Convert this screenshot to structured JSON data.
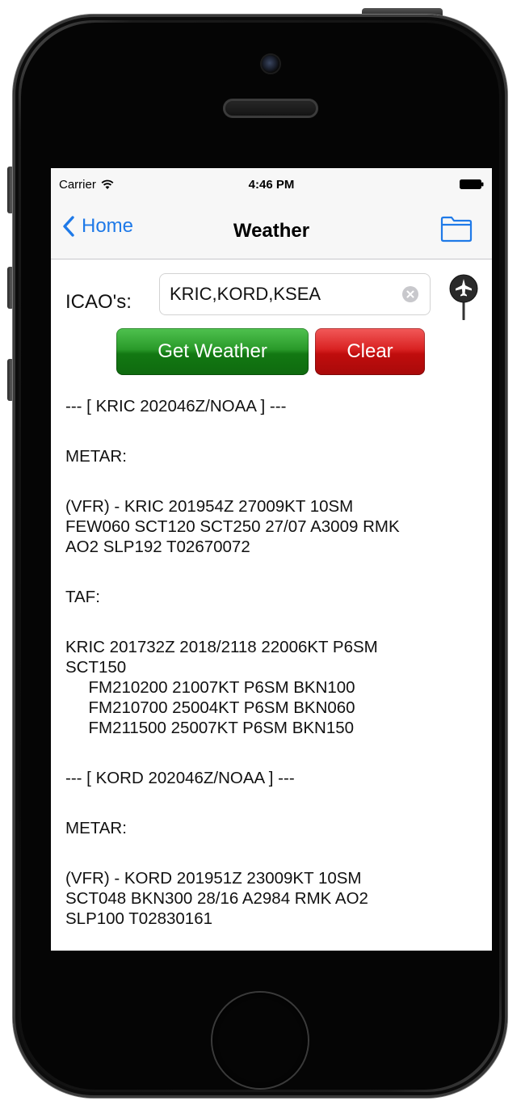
{
  "statusbar": {
    "carrier": "Carrier",
    "time": "4:46 PM"
  },
  "navbar": {
    "back_label": "Home",
    "title": "Weather"
  },
  "form": {
    "icao_label": "ICAO's:",
    "icao_value": "KRIC,KORD,KSEA",
    "get_weather_label": "Get Weather",
    "clear_label": "Clear"
  },
  "report": {
    "kric_header": "--- [ KRIC 202046Z/NOAA ] ---",
    "kric_metar_label": "METAR:",
    "kric_metar_1": "(VFR) - KRIC 201954Z 27009KT 10SM",
    "kric_metar_2": "FEW060 SCT120 SCT250 27/07 A3009 RMK",
    "kric_metar_3": "AO2 SLP192 T02670072",
    "kric_taf_label": "TAF:",
    "kric_taf_1": "KRIC 201732Z 2018/2118 22006KT P6SM",
    "kric_taf_2": "SCT150",
    "kric_taf_3": "     FM210200 21007KT P6SM BKN100",
    "kric_taf_4": "     FM210700 25004KT P6SM BKN060",
    "kric_taf_5": "     FM211500 25007KT P6SM BKN150",
    "kord_header": "--- [ KORD 202046Z/NOAA ] ---",
    "kord_metar_label": "METAR:",
    "kord_metar_1": "(VFR) - KORD 201951Z 23009KT 10SM",
    "kord_metar_2": "SCT048 BKN300 28/16 A2984 RMK AO2",
    "kord_metar_3": "SLP100 T02830161"
  },
  "colors": {
    "ios_blue": "#1f7ae8",
    "get_weather_green": "#2a9a2a",
    "clear_red": "#d92222"
  },
  "icons": {
    "wifi": "wifi-icon",
    "battery": "battery-icon",
    "back": "chevron-left-icon",
    "folder": "folder-icon",
    "clear_input": "clear-circle-icon",
    "location": "airplane-pin-icon"
  }
}
